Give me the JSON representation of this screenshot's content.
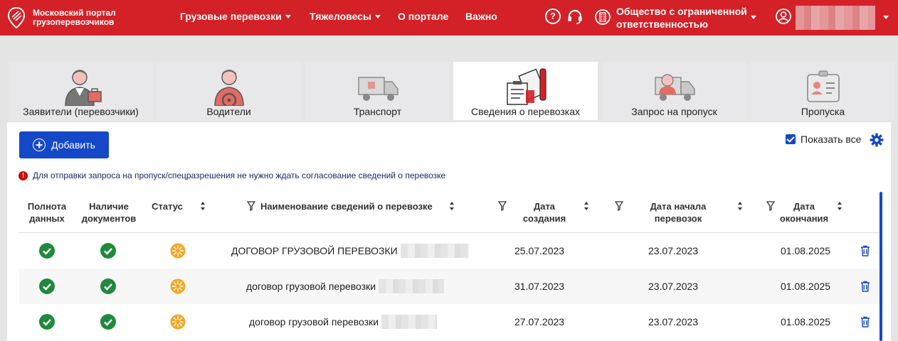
{
  "header": {
    "logo_text": "Московский портал грузоперевозчиков",
    "nav": [
      {
        "label": "Грузовые перевозки",
        "has_dropdown": true
      },
      {
        "label": "Тяжеловесы",
        "has_dropdown": true
      },
      {
        "label": "О портале",
        "has_dropdown": false
      },
      {
        "label": "Важно",
        "has_dropdown": false
      }
    ],
    "help_glyph": "?",
    "organization": "Общество с ограниченной ответственностью",
    "icons": [
      "help-icon",
      "headset-icon",
      "building-icon",
      "user-icon"
    ]
  },
  "tabs": [
    {
      "label": "Заявители (перевозчики)",
      "icon": "applicant-icon",
      "active": false
    },
    {
      "label": "Водители",
      "icon": "driver-icon",
      "active": false
    },
    {
      "label": "Транспорт",
      "icon": "truck-icon",
      "active": false
    },
    {
      "label": "Сведения о перевозках",
      "icon": "documents-icon",
      "active": true
    },
    {
      "label": "Запрос на пропуск",
      "icon": "pass-request-icon",
      "active": false
    },
    {
      "label": "Пропуска",
      "icon": "pass-card-icon",
      "active": false
    }
  ],
  "toolbar": {
    "add_label": "Добавить",
    "show_all_label": "Показать все",
    "show_all_checked": true
  },
  "notice": {
    "glyph": "!",
    "text": "Для отправки запроса на пропуск/спецразрешения не нужно ждать согласование сведений о перевозке"
  },
  "table": {
    "columns": {
      "completeness": "Полнота данных",
      "documents": "Наличие документов",
      "status": "Статус",
      "name": "Наименование сведений о перевозке",
      "created": "Дата создания",
      "start": "Дата начала перевозок",
      "end": "Дата окончания"
    },
    "rows": [
      {
        "name": "ДОГОВОР ГРУЗОВОЙ ПЕРЕВОЗКИ",
        "created": "25.07.2023",
        "start": "23.07.2023",
        "end": "01.08.2025"
      },
      {
        "name": "договор грузовой перевозки",
        "created": "31.07.2023",
        "start": "23.07.2023",
        "end": "01.08.2025"
      },
      {
        "name": "договор грузовой перевозки",
        "created": "27.07.2023",
        "start": "23.07.2023",
        "end": "01.08.2025"
      }
    ]
  },
  "colors": {
    "header_red": "#d42027",
    "primary_blue": "#1547c9",
    "ok_green": "#1f8a3c",
    "status_orange": "#f5a623",
    "notice_red": "#d40000"
  }
}
